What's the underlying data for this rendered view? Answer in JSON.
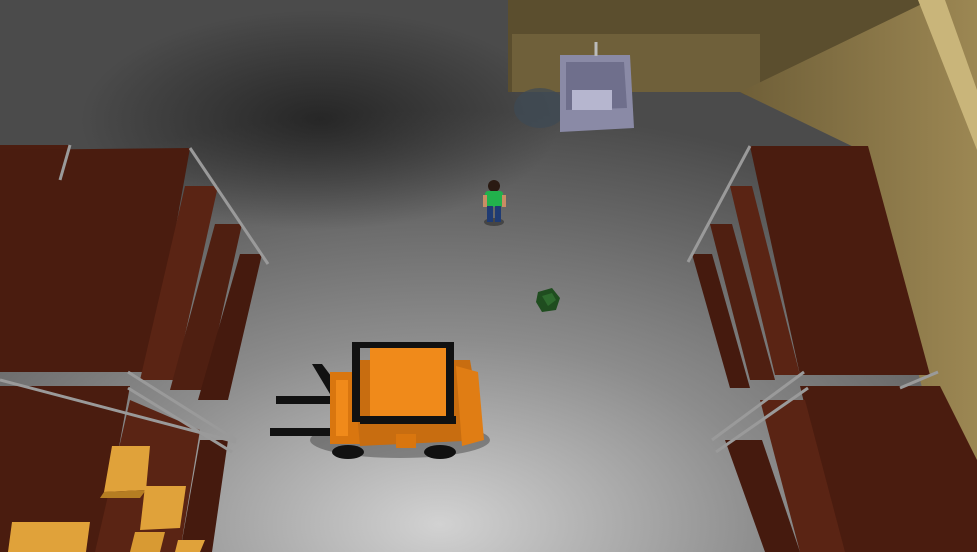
{
  "scene": {
    "type": "top-down warehouse game view",
    "colors": {
      "floor_light": "#a9a9a9",
      "floor_dark": "#2e2e2e",
      "wall": "#8e7a4c",
      "wall_top": "#c7b276",
      "rack_wood": "#4a1c0f",
      "rack_wood_light": "#5e2614",
      "rack_rail": "#9a9a9a",
      "box": "#e0a23a",
      "forklift_body": "#f08a1a",
      "forklift_dark": "#111111",
      "bin": "#9c9cb8",
      "player_shirt": "#22b14c",
      "player_pants": "#1f3b73",
      "pickup": "#1f4d1f"
    },
    "objects": [
      {
        "name": "player",
        "icon": "character"
      },
      {
        "name": "forklift",
        "icon": "forklift"
      },
      {
        "name": "dumpster-bin",
        "icon": "bin"
      },
      {
        "name": "pickup-item",
        "icon": "green-crate"
      }
    ]
  }
}
